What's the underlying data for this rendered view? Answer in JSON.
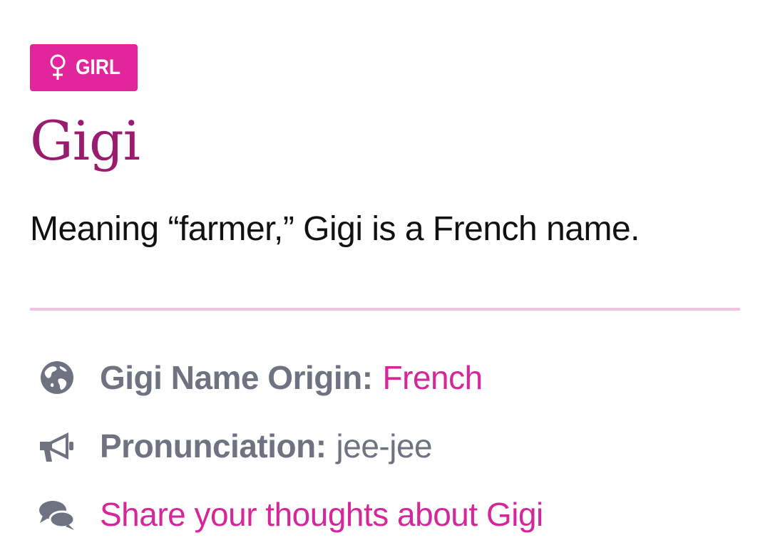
{
  "badge": {
    "icon": "female-icon",
    "label": "GIRL",
    "color": "#e0269a"
  },
  "name": {
    "title": "Gigi",
    "color": "#9b1b6f"
  },
  "meaning": "Meaning “farmer,” Gigi is a French name.",
  "details": {
    "origin": {
      "icon": "globe-icon",
      "label": "Gigi Name Origin:",
      "value": "French"
    },
    "pronunciation": {
      "icon": "megaphone-icon",
      "label": "Pronunciation:",
      "value": "jee-jee"
    },
    "share": {
      "icon": "comments-icon",
      "text": "Share your thoughts about Gigi"
    }
  },
  "colors": {
    "accent": "#d6269b",
    "muted": "#6f7280",
    "divider": "#f2c3df"
  }
}
